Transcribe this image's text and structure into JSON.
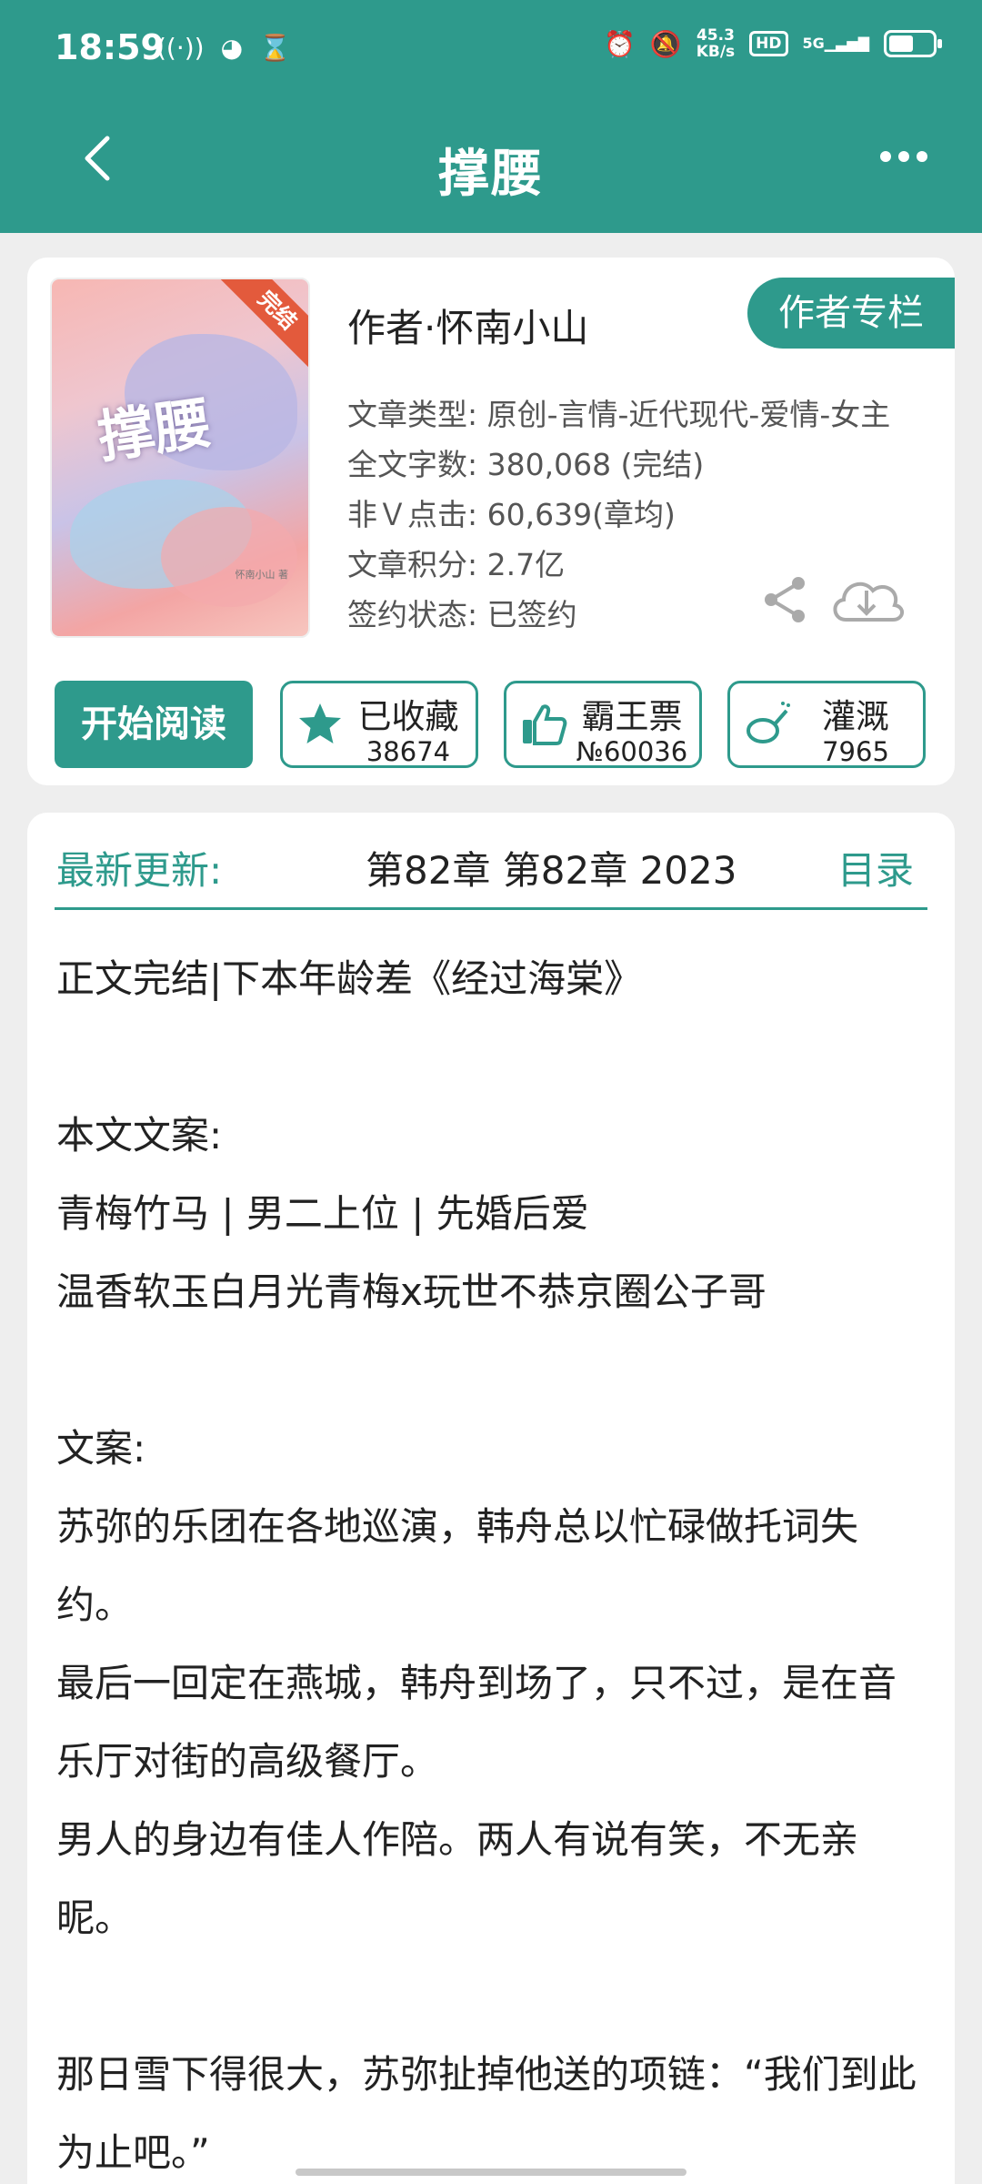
{
  "status_bar": {
    "time": "18:59",
    "left_icons": [
      "signal-waves-icon",
      "app-icon",
      "hourglass-icon"
    ],
    "speed_value": "45.3",
    "speed_unit": "KB/s",
    "hd_label": "HD",
    "network": "5G"
  },
  "header": {
    "title": "撑腰",
    "back_icon": "chevron-left-icon",
    "more_icon": "more-dots-icon",
    "color": "#2e9a8c"
  },
  "book": {
    "cover_title": "撑腰",
    "cover_author": "怀南小山 著",
    "ribbon": "完结",
    "author": "作者·怀南小山",
    "author_button": "作者专栏",
    "meta": [
      "文章类型: 原创-言情-近代现代-爱情-女主",
      "全文字数: 380,068 (完结)",
      "非Ｖ点击: 60,639(章均)",
      "文章积分: 2.7亿",
      "签约状态: 已签约"
    ],
    "read_button": "开始阅读",
    "stats": [
      {
        "label": "已收藏",
        "value": "38674",
        "icon": "star-icon"
      },
      {
        "label": "霸王票",
        "value": "№60036",
        "icon": "thumbs-up-icon"
      },
      {
        "label": "灌溉",
        "value": "7965",
        "icon": "watering-can-icon"
      }
    ]
  },
  "latest": {
    "label": "最新更新:",
    "value": "第82章  第82章  2023",
    "toc": "目录"
  },
  "synopsis": [
    "正文完结|下本年龄差《经过海棠》",
    "",
    "本文文案:",
    "青梅竹马 | 男二上位 | 先婚后爱",
    "温香软玉白月光青梅x玩世不恭京圈公子哥",
    "",
    "文案:",
    "苏弥的乐团在各地巡演，韩舟总以忙碌做托词失约。",
    "最后一回定在燕城，韩舟到场了，只不过，是在音乐厅对街的高级餐厅。",
    "男人的身边有佳人作陪。两人有说有笑，不无亲昵。",
    "",
    "那日雪下得很大，苏弥扯掉他送的项链：“我们到此为止吧。”"
  ]
}
